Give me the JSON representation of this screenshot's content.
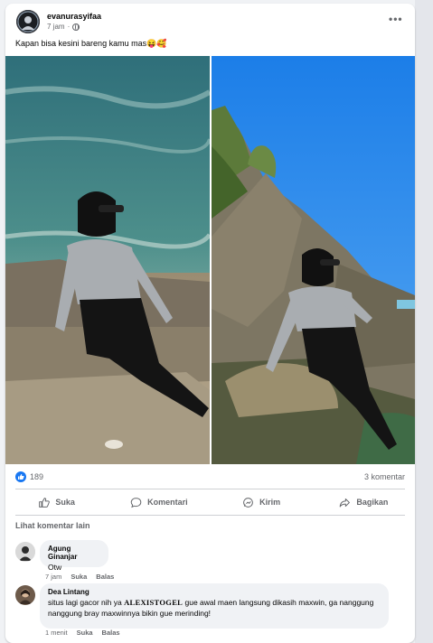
{
  "post": {
    "author": "evanurasyifaa",
    "time": "7 jam",
    "caption": "Kapan bisa kesini bareng kamu mas😝🥰",
    "reaction_count": "189",
    "comment_count": "3 komentar"
  },
  "actions": {
    "like": "Suka",
    "comment": "Komentari",
    "send": "Kirim",
    "share": "Bagikan"
  },
  "comments_section": {
    "more_label": "Lihat komentar lain",
    "comments": [
      {
        "name": "Agung Ginanjar",
        "text": "Otw",
        "time": "7 jam",
        "like": "Suka",
        "reply": "Balas"
      },
      {
        "name": "Dea Lintang",
        "text_before": "situs lagi gacor nih ya ",
        "text_bold": "ALEXISTOGEL",
        "text_after": " gue awal maen langsung dikasih maxwin, ga nanggung nanggung bray maxwinnya bikin gue merinding!",
        "time": "1 menit",
        "like": "Suka",
        "reply": "Balas"
      }
    ]
  },
  "colors": {
    "accent": "#1877f2",
    "muted": "#65676b",
    "bubble": "#f0f2f5"
  },
  "icons": [
    "globe-icon",
    "more-options-icon",
    "like-reaction-icon",
    "like-icon",
    "comment-icon",
    "send-icon",
    "share-icon"
  ]
}
